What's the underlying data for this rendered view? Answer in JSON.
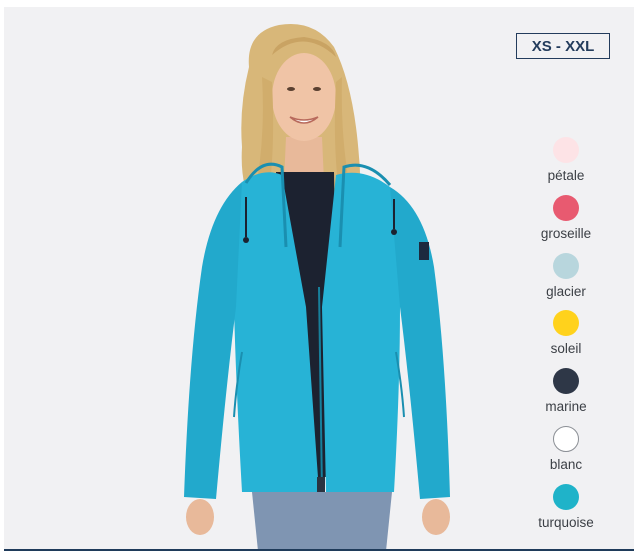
{
  "size_range": "XS - XXL",
  "colors": [
    {
      "label": "pétale",
      "hex": "#fde3e6"
    },
    {
      "label": "groseille",
      "hex": "#e85a70"
    },
    {
      "label": "glacier",
      "hex": "#b8d6dd"
    },
    {
      "label": "soleil",
      "hex": "#ffd21c"
    },
    {
      "label": "marine",
      "hex": "#2e3747"
    },
    {
      "label": "blanc",
      "hex": "#ffffff"
    },
    {
      "label": "turquoise",
      "hex": "#1fb3c9"
    }
  ],
  "jacket_color": "#27b3d6",
  "brand_accent": "#233c5c"
}
